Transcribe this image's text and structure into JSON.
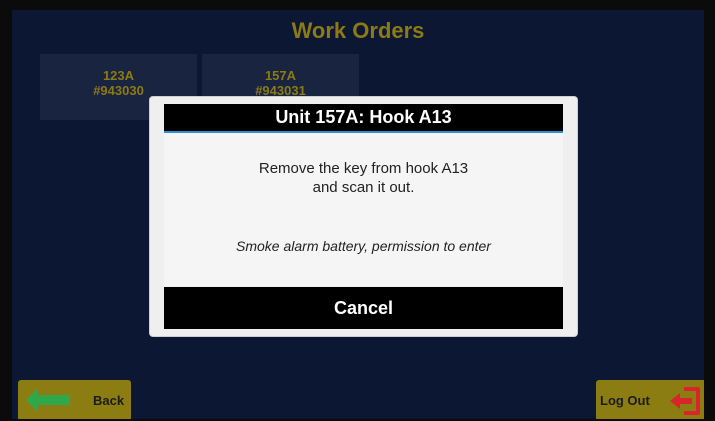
{
  "header": {
    "title": "Work Orders"
  },
  "work_orders": [
    {
      "unit": "123A",
      "order": "#943030"
    },
    {
      "unit": "157A",
      "order": "#943031"
    }
  ],
  "modal": {
    "title": "Unit 157A: Hook A13",
    "message_line1": "Remove the key from hook A13",
    "message_line2": "and scan it out.",
    "note": "Smoke alarm battery, permission to enter",
    "cancel_label": "Cancel"
  },
  "nav": {
    "back_label": "Back",
    "logout_label": "Log Out",
    "back_icon": "arrow-left-icon",
    "logout_icon": "exit-door-icon"
  },
  "colors": {
    "background": "#0b1733",
    "accent": "#8c7d12",
    "tile": "#182440",
    "modal_header": "#000000",
    "header_underline": "#2f8fd6",
    "arrow_green": "#2fa84a",
    "exit_red": "#d8252b"
  }
}
